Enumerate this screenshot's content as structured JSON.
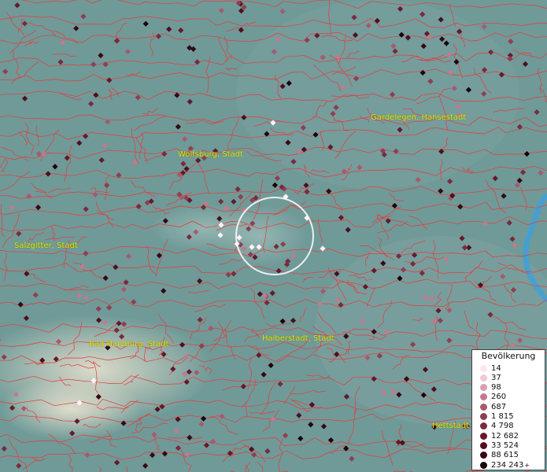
{
  "map": {
    "colors": {
      "background": "#6f9a98",
      "border": "#e83a3a",
      "river": "#3fa0d8",
      "label": "#e6e600"
    },
    "cities": [
      {
        "id": "wolfsburg",
        "name": "Wolfsburg, Stadt"
      },
      {
        "id": "gardelegen",
        "name": "Gardelegen, Hansestadt"
      },
      {
        "id": "salzgitter",
        "name": "Salzgitter, Stadt"
      },
      {
        "id": "bad-harzburg",
        "name": "Bad Harzburg, Stadt"
      },
      {
        "id": "halberstadt",
        "name": "Halberstadt, Stadt"
      },
      {
        "id": "hettstedt",
        "name": "Hettstadt"
      }
    ]
  },
  "legend": {
    "title": "Bevölkerung",
    "items": [
      {
        "label": "14",
        "color": "#fbe6ef"
      },
      {
        "label": "37",
        "color": "#f0c9d6"
      },
      {
        "label": "98",
        "color": "#d99fb1"
      },
      {
        "label": "260",
        "color": "#c17a8e"
      },
      {
        "label": "687",
        "color": "#a75a6d"
      },
      {
        "label": "1 815",
        "color": "#8f3e52"
      },
      {
        "label": "4 798",
        "color": "#7a2a3d"
      },
      {
        "label": "12 682",
        "color": "#65192b"
      },
      {
        "label": "33 524",
        "color": "#4e0f1e"
      },
      {
        "label": "88 615",
        "color": "#370612"
      },
      {
        "label": "234 243",
        "color": "#1a0208",
        "plus": "+"
      }
    ]
  }
}
